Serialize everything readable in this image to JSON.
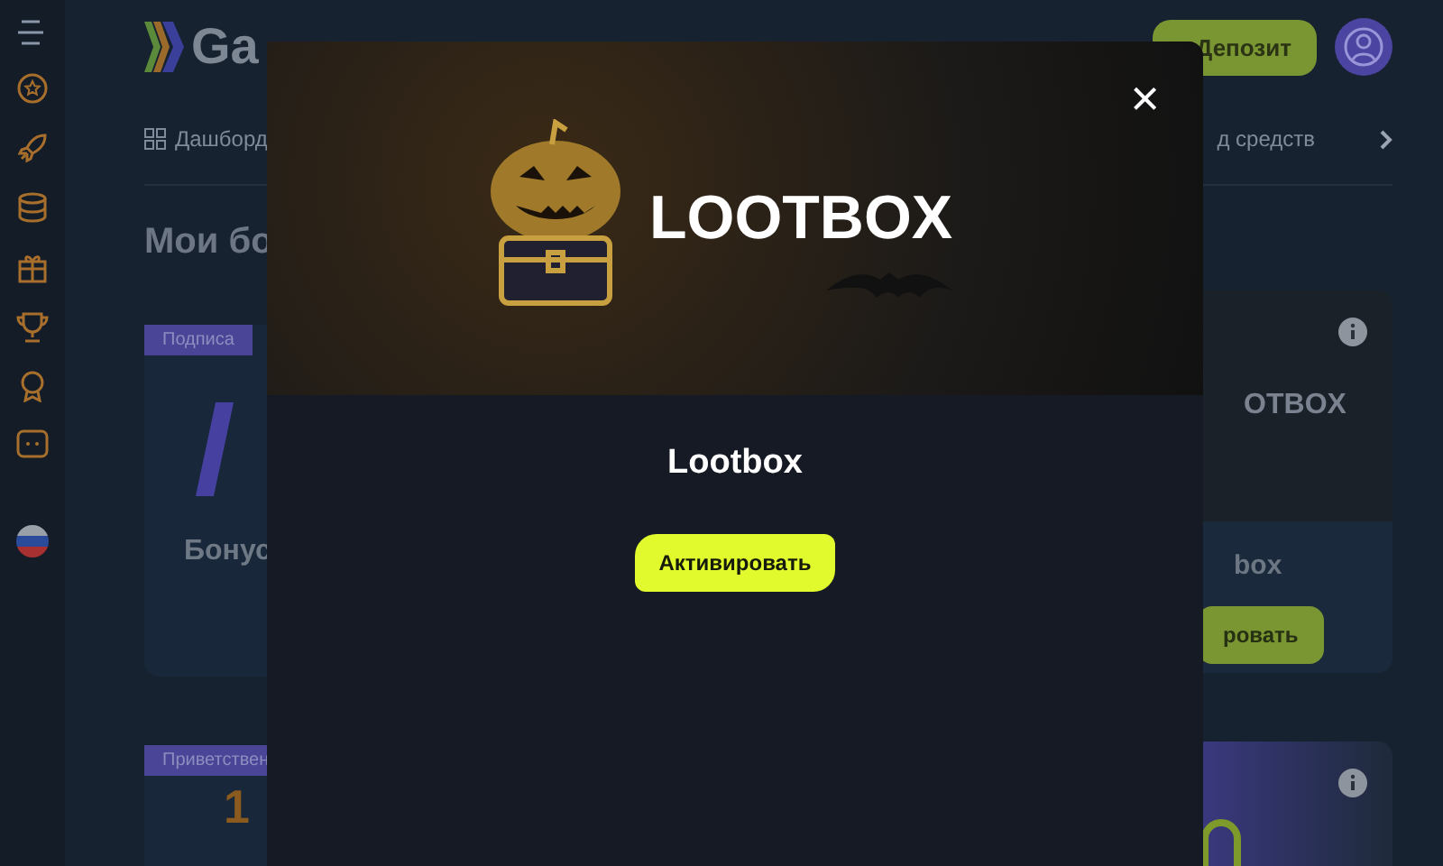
{
  "header": {
    "logo_text": "Ga",
    "deposit_button": "Депозит"
  },
  "nav": {
    "left_item": "Дашборд",
    "right_item": "д средств"
  },
  "page_title": "Мои бо",
  "left_cards": [
    {
      "tag": "Подписа",
      "title": "Бонус"
    },
    {
      "tag": "Приветствен",
      "title": "1"
    }
  ],
  "right_cards": [
    {
      "banner_text": "OTBOX",
      "title": "box",
      "button": "ровать"
    }
  ],
  "modal": {
    "banner_text": "LOOTBOX",
    "close": "×",
    "title": "Lootbox",
    "button": "Активировать"
  }
}
